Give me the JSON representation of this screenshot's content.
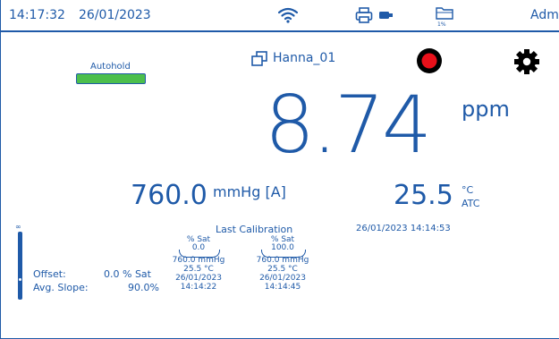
{
  "status_bar": {
    "time": "14:17:32",
    "date": "26/01/2023",
    "storage_percent": "1%",
    "user": "Admin"
  },
  "autohold": {
    "label": "Autohold"
  },
  "profile": {
    "name": "Hanna_01"
  },
  "reading": {
    "value": "8.74",
    "unit": "ppm"
  },
  "pressure": {
    "value": "760.0",
    "unit": "mmHg [A]"
  },
  "temperature": {
    "value": "25.5",
    "unit": "°C",
    "mode": "ATC"
  },
  "calibration": {
    "title": "Last Calibration",
    "datetime": "26/01/2023  14:14:53",
    "offset_label": "Offset:",
    "offset_value": "0.0 % Sat",
    "slope_label": "Avg. Slope:",
    "slope_value": "90.0%",
    "points": [
      {
        "unit": "% Sat",
        "value": "0.0",
        "pressure": "760.0 mmHg",
        "temp": "25.5 °C",
        "date": "26/01/2023",
        "time": "14:14:22"
      },
      {
        "unit": "% Sat",
        "value": "100.0",
        "pressure": "760.0 mmHg",
        "temp": "25.5 °C",
        "date": "26/01/2023",
        "time": "14:14:45"
      }
    ]
  },
  "gauge": {
    "top_symbol": "∞"
  },
  "colors": {
    "accent": "#1f5aa8",
    "autohold_bar": "#4cbf4c",
    "record": "#e8101a"
  },
  "icons": [
    "wifi-icon",
    "printer-icon",
    "usb-icon",
    "folder-icon",
    "copy-icon",
    "record-icon",
    "gear-icon"
  ]
}
